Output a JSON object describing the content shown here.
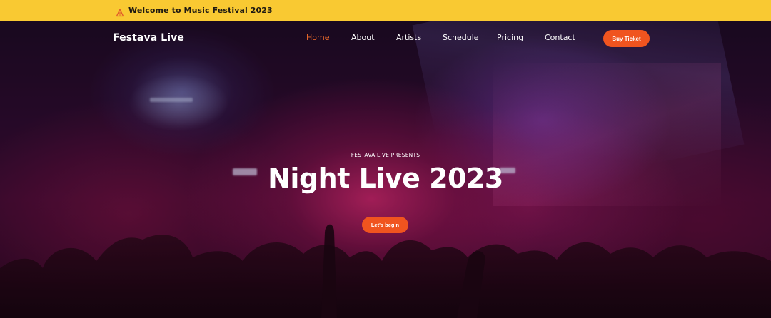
{
  "topbar": {
    "icon": "alert-triangle-icon",
    "text": "Welcome to Music Festival 2023",
    "background": "#f9c932"
  },
  "nav": {
    "brand": "Festava Live",
    "links": [
      {
        "label": "Home",
        "active": true
      },
      {
        "label": "About",
        "active": false
      },
      {
        "label": "Artists",
        "active": false
      },
      {
        "label": "Schedule",
        "active": false
      },
      {
        "label": "Pricing",
        "active": false
      },
      {
        "label": "Contact",
        "active": false
      }
    ],
    "cta": "Buy Ticket",
    "active_color": "#f26c2a"
  },
  "hero": {
    "eyebrow": "FESTAVA LIVE PRESENTS",
    "title": "Night Live 2023",
    "cta": "Let's begin"
  },
  "colors": {
    "accent": "#f0541f",
    "announcement": "#f9c932"
  }
}
